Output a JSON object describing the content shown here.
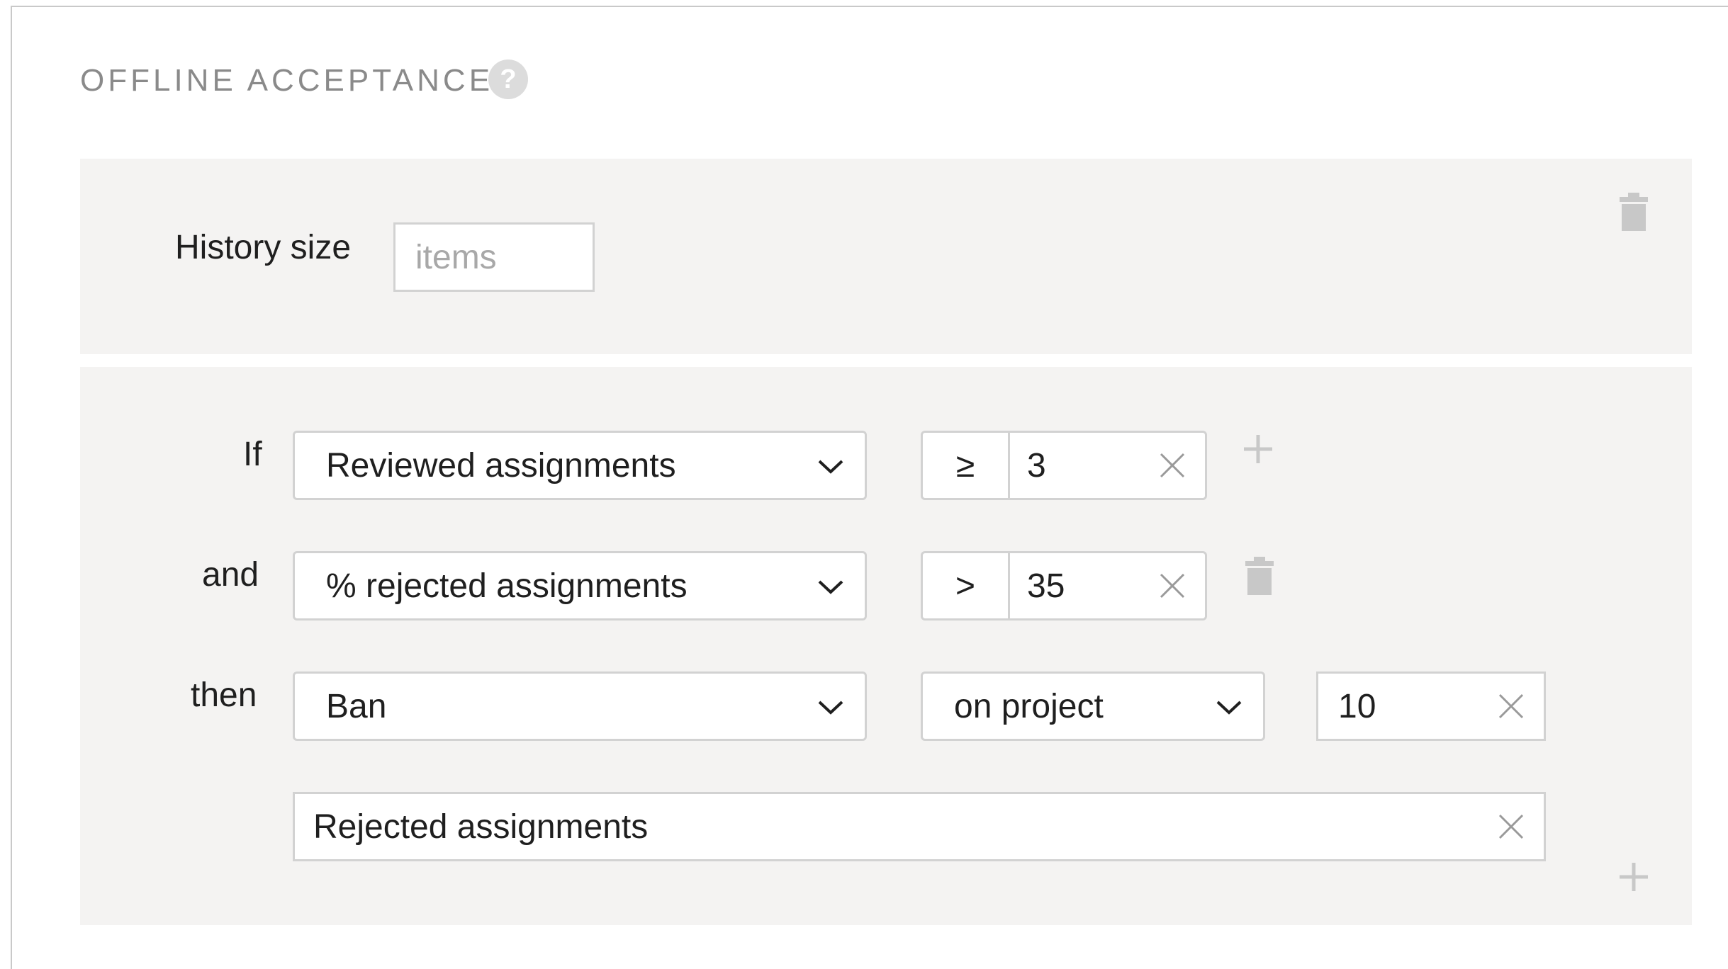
{
  "section": {
    "title": "OFFLINE ACCEPTANCE",
    "help_icon": "question-circle-icon"
  },
  "history": {
    "label": "History size",
    "placeholder": "items",
    "delete_icon": "trash-icon"
  },
  "rule": {
    "if_label": "If",
    "and_label": "and",
    "then_label": "then",
    "conditions": [
      {
        "field": "Reviewed assignments",
        "operator": "≥",
        "value": "3"
      },
      {
        "field": "% rejected assignments",
        "operator": ">",
        "value": "35"
      }
    ],
    "action": {
      "type": "Ban",
      "scope": "on project",
      "duration": "10",
      "reason": "Rejected assignments"
    },
    "add_condition_icon": "plus-icon",
    "delete_condition_icon": "trash-icon",
    "add_rule_icon": "plus-icon"
  },
  "colors": {
    "panel_bg": "#f4f3f2",
    "border": "#d2d2d2",
    "muted_icon": "#c8c8c8",
    "title": "#8a8a8a"
  }
}
